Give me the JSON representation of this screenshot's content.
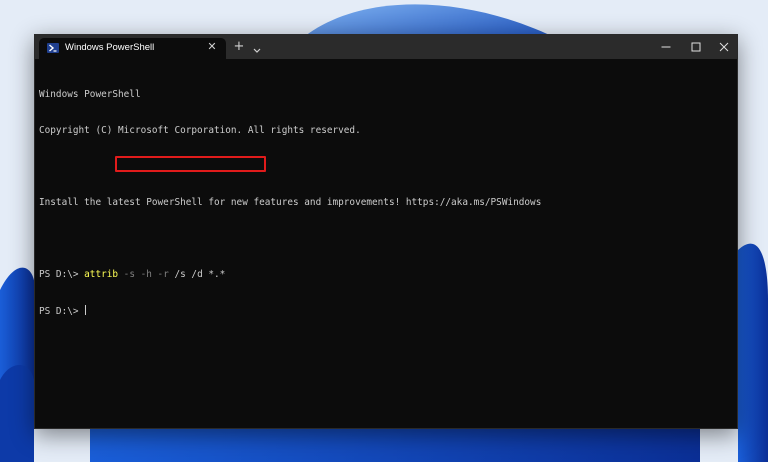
{
  "colors": {
    "wallpaper_bg": "#dfe9f6",
    "wallpaper_bloom": "#1565d8",
    "terminal_bg": "#0c0c0c",
    "titlebar_bg": "#2b2b2b",
    "text": "#cccccc",
    "command": "#ffff55",
    "parameter": "#808080",
    "highlight_border": "#e11b1b"
  },
  "tab": {
    "icon": "powershell-icon",
    "title": "Windows PowerShell",
    "close_icon": "close-icon"
  },
  "toolbar": {
    "new_tab_label": "+",
    "dropdown_icon": "chevron-down-icon"
  },
  "window_controls": [
    "minimize-icon",
    "maximize-icon",
    "close-icon"
  ],
  "terminal": {
    "line1": "Windows PowerShell",
    "line2": "Copyright (C) Microsoft Corporation. All rights reserved.",
    "line3": "Install the latest PowerShell for new features and improvements! https://aka.ms/PSWindows",
    "prompt": "PS D:\\> ",
    "command": {
      "name": "attrib",
      "args": [
        {
          "text": " -s",
          "kind": "param"
        },
        {
          "text": " -h",
          "kind": "param"
        },
        {
          "text": " -r",
          "kind": "param"
        },
        {
          "text": " /s /d *.*",
          "kind": "plain"
        }
      ]
    }
  }
}
